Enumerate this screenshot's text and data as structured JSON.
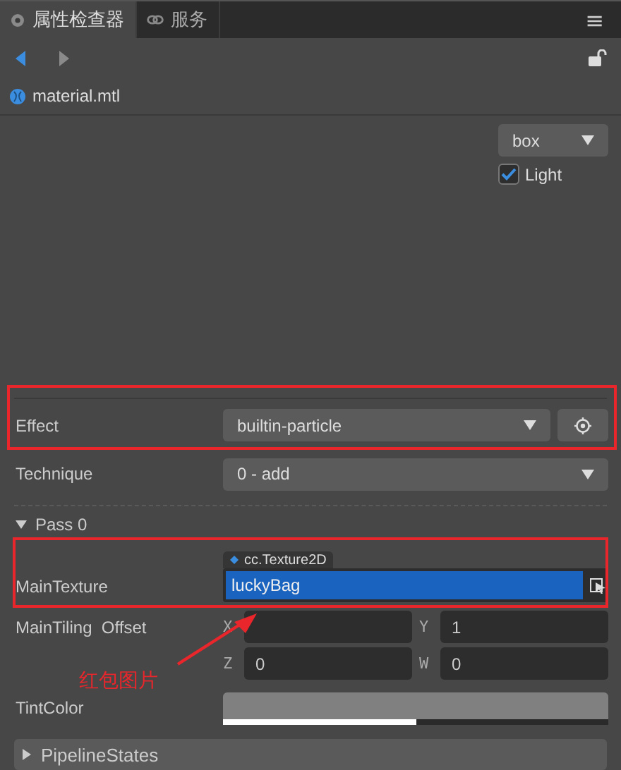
{
  "tabs": [
    {
      "label": "属性检查器",
      "selected": true
    },
    {
      "label": "服务",
      "selected": false
    }
  ],
  "menu_button": "≡",
  "file": {
    "name": "material.mtl"
  },
  "preview": {
    "shape": "box",
    "light": {
      "label": "Light",
      "checked": true
    }
  },
  "effect": {
    "label": "Effect",
    "value": "builtin-particle"
  },
  "technique": {
    "label": "Technique",
    "value": "0 - add"
  },
  "pass": {
    "title": "Pass 0",
    "expanded": true
  },
  "main_texture": {
    "label": "MainTexture",
    "type": "cc.Texture2D",
    "value": "luckyBag"
  },
  "main_tiling": {
    "label": "MainTiling  Offset",
    "fields": [
      {
        "axis": "X"
      },
      {
        "axis": "Y",
        "value": "1"
      },
      {
        "axis": "Z",
        "value": "0"
      },
      {
        "axis": "W",
        "value": "0"
      }
    ]
  },
  "tint_color": {
    "label": "TintColor",
    "color": "#808080",
    "level": 0.5
  },
  "pipeline": {
    "title": "PipelineStates",
    "expanded": false
  },
  "annotation": {
    "text": "红包图片"
  }
}
